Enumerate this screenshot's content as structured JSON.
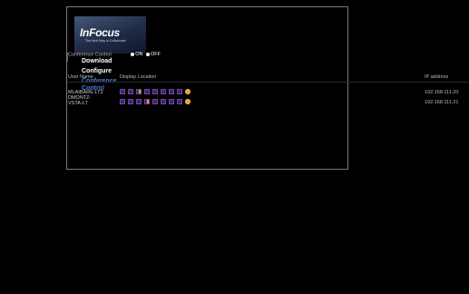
{
  "logo": {
    "brand": "InFocus",
    "tagline": "The Next Way to Collaborate"
  },
  "sidebar": {
    "items": [
      {
        "label": "Download",
        "active": false
      },
      {
        "label": "Configure",
        "active": false
      },
      {
        "label": "Conference Control",
        "active": true
      }
    ]
  },
  "conference": {
    "label": "Conference Control",
    "on_label": "ON",
    "off_label": "OFF",
    "state": "ON"
  },
  "table": {
    "columns": [
      "User Name",
      "Display Location",
      "IP address"
    ],
    "rows": [
      {
        "user": "MLAIBARE-LT2",
        "ip": "192.168.111.20",
        "highlighted_slot": "quadrant-2"
      },
      {
        "user": "DMONTZ-VSTA-LT",
        "ip": "192.168.111.21",
        "highlighted_slot": "quadrant-3"
      }
    ],
    "rows_display": [
      {
        "name_line1": "MLAIBARE-LT2",
        "name_line2": "DMONTZ-"
      },
      {
        "name_line1": "VSTA-LT",
        "name_line2": ""
      }
    ],
    "display_icons": [
      "fullscreen-icon",
      "quadrant-1-icon",
      "quadrant-2-icon",
      "quadrant-3-icon",
      "quadrant-4-icon",
      "split-left-icon",
      "split-right-icon",
      "window-icon",
      "pc-icon"
    ]
  },
  "colors": {
    "accent": "#4d79d6",
    "highlight": "#ff9c1a",
    "icon_base": "#40246a",
    "background": "#000000"
  }
}
